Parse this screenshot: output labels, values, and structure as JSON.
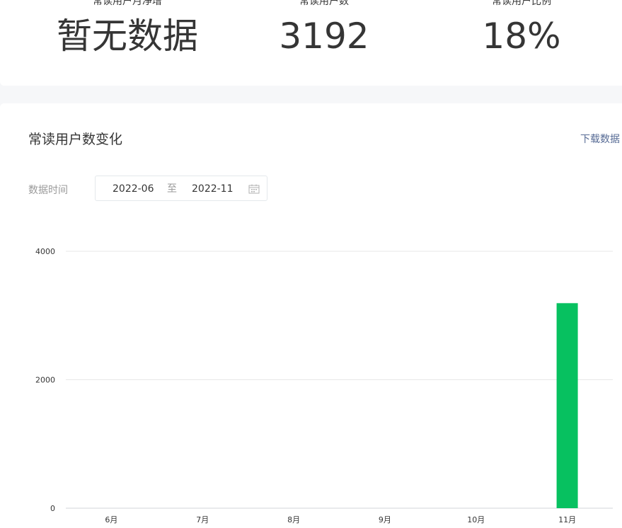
{
  "stats": {
    "net_growth": {
      "label": "常读用户月净增",
      "value": "暂无数据"
    },
    "users": {
      "label": "常读用户数",
      "value": "3192"
    },
    "ratio": {
      "label": "常读用户比例",
      "value": "18%"
    }
  },
  "trend": {
    "title": "常读用户数变化",
    "download_label": "下载数据",
    "date_filter": {
      "label": "数据时间",
      "start": "2022-06",
      "separator": "至",
      "end": "2022-11",
      "icon": "calendar-icon"
    }
  },
  "colors": {
    "bar": "#07c160",
    "link": "#576b95",
    "grid": "#e7e7e7"
  },
  "chart_data": {
    "type": "bar",
    "categories": [
      "6月",
      "7月",
      "8月",
      "9月",
      "10月",
      "11月"
    ],
    "values": [
      0,
      0,
      0,
      0,
      0,
      3192
    ],
    "ylim": [
      0,
      4000
    ],
    "yticks": [
      0,
      2000,
      4000
    ],
    "grid": true
  }
}
